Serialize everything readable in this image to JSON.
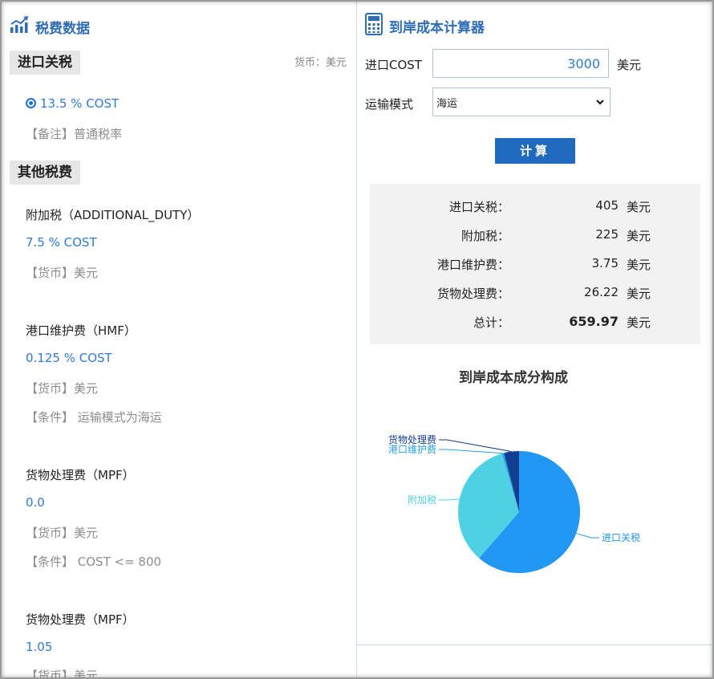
{
  "left_panel": {
    "title": "税费数据",
    "import_duty": {
      "tag": "进口关税",
      "currency_note": "货币：美元",
      "rate": "13.5 % COST",
      "remark": "【备注】普通税率"
    },
    "other_fees": {
      "tag": "其他税费",
      "items": [
        {
          "name": "附加税（ADDITIONAL_DUTY）",
          "rate": "7.5 % COST",
          "lines": [
            "【货币】美元"
          ]
        },
        {
          "name": "港口维护费（HMF）",
          "rate": "0.125 % COST",
          "lines": [
            "【货币】美元",
            "【条件】 运输模式为海运"
          ]
        },
        {
          "name": "货物处理费（MPF）",
          "rate": "0.0",
          "lines": [
            "【货币】美元",
            "【条件】 COST <= 800"
          ]
        },
        {
          "name": "货物处理费（MPF）",
          "rate": "1.05",
          "lines": [
            "【货币】美元"
          ]
        }
      ]
    }
  },
  "right_panel": {
    "title": "到岸成本计算器",
    "cost_label": "进口COST",
    "cost_value": "3000",
    "cost_unit": "美元",
    "mode_label": "运输模式",
    "mode_value": "海运",
    "calc_button": "计算",
    "results": [
      {
        "label": "进口关税：",
        "value": "405",
        "unit": "美元"
      },
      {
        "label": "附加税：",
        "value": "225",
        "unit": "美元"
      },
      {
        "label": "港口维护费：",
        "value": "3.75",
        "unit": "美元"
      },
      {
        "label": "货物处理费：",
        "value": "26.22",
        "unit": "美元"
      },
      {
        "label": "总计：",
        "value": "659.97",
        "unit": "美元"
      }
    ]
  },
  "colors": {
    "accent": "#2f6db5",
    "button": "#1f6abf",
    "blue_text": "#2f7bd6"
  },
  "chart_data": {
    "type": "pie",
    "title": "到岸成本成分构成",
    "slices": [
      {
        "name": "进口关税",
        "value": 405,
        "color": "#2196f3"
      },
      {
        "name": "附加税",
        "value": 225,
        "color": "#4fd1e3"
      },
      {
        "name": "港口维护费",
        "value": 3.75,
        "color": "#27a3e0"
      },
      {
        "name": "货物处理费",
        "value": 26.22,
        "color": "#123f91"
      }
    ]
  }
}
